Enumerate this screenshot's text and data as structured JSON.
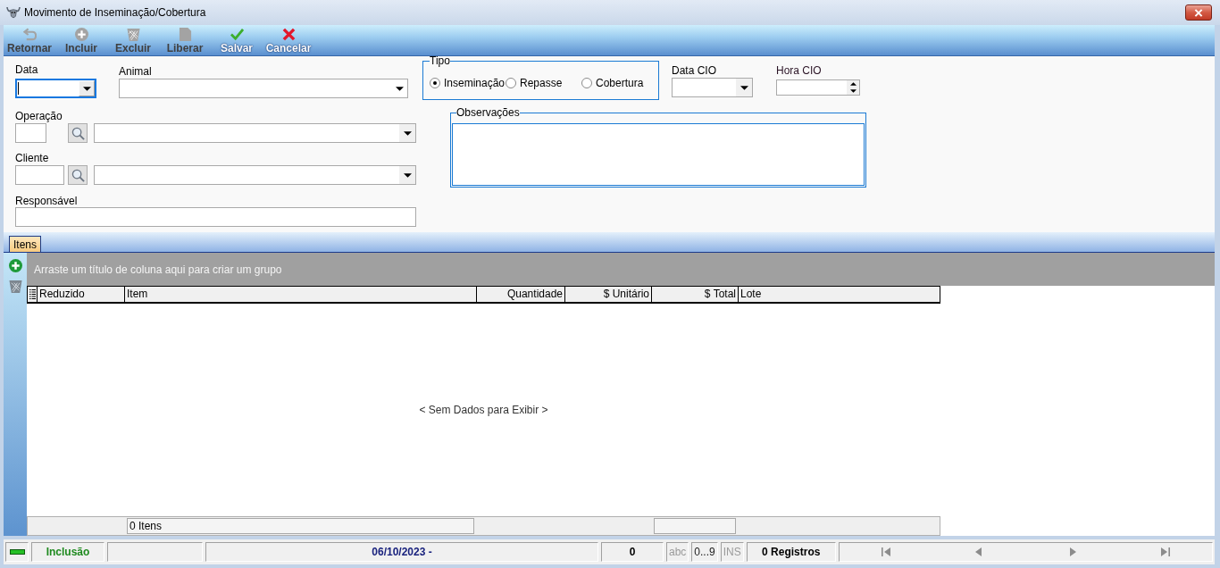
{
  "window": {
    "title": "Movimento de Inseminação/Cobertura"
  },
  "toolbar": [
    {
      "kind": "return",
      "label": "Retornar",
      "disabled": true
    },
    {
      "kind": "add",
      "label": "Incluir",
      "disabled": true
    },
    {
      "kind": "delete",
      "label": "Excluir",
      "disabled": true
    },
    {
      "kind": "release",
      "label": "Liberar",
      "disabled": true
    },
    {
      "kind": "save",
      "label": "Salvar",
      "disabled": false
    },
    {
      "kind": "cancel",
      "label": "Cancelar",
      "disabled": false
    }
  ],
  "form": {
    "data": {
      "label": "Data",
      "focused": true
    },
    "animal": {
      "label": "Animal",
      "focused": false
    },
    "tipo": {
      "label": "Tipo",
      "options": [
        {
          "label": "Inseminação",
          "selected": true
        },
        {
          "label": "Repasse",
          "selected": false
        },
        {
          "label": "Cobertura",
          "selected": false
        }
      ]
    },
    "data_cio": {
      "label": "Data CIO",
      "focused": false
    },
    "hora_cio": {
      "label": "Hora CIO",
      "focused": false
    },
    "operacao": {
      "label": "Operação",
      "focused": false
    },
    "observacoes": {
      "label": "Observações",
      "focused": false
    },
    "cliente": {
      "label": "Cliente",
      "focused": false
    },
    "responsavel": {
      "label": "Responsável",
      "focused": false
    }
  },
  "tabs": [
    {
      "label": "Itens",
      "selected": true
    }
  ],
  "grid": {
    "group_hint": "Arraste um título de coluna aqui para criar um grupo",
    "columns": [
      {
        "label": "Reduzido"
      },
      {
        "label": "Item"
      },
      {
        "label": "Quantidade"
      },
      {
        "label": "$ Unitário"
      },
      {
        "label": "$ Total"
      },
      {
        "label": "Lote"
      }
    ],
    "empty_text": "< Sem Dados para Exibir >",
    "footer": {
      "item_count": "0 Itens"
    }
  },
  "status_bar": {
    "mode": "Inclusão",
    "date": "06/10/2023 -",
    "count": "0",
    "indicators": [
      {
        "label": "abc",
        "on": false
      },
      {
        "label": "0...9",
        "on": true
      },
      {
        "label": "INS",
        "on": false
      }
    ],
    "records": "0 Registros",
    "navigation": [
      {
        "kind": "first",
        "disabled": true
      },
      {
        "kind": "prev",
        "disabled": true
      },
      {
        "kind": "next",
        "disabled": true
      },
      {
        "kind": "last",
        "disabled": true
      }
    ]
  }
}
